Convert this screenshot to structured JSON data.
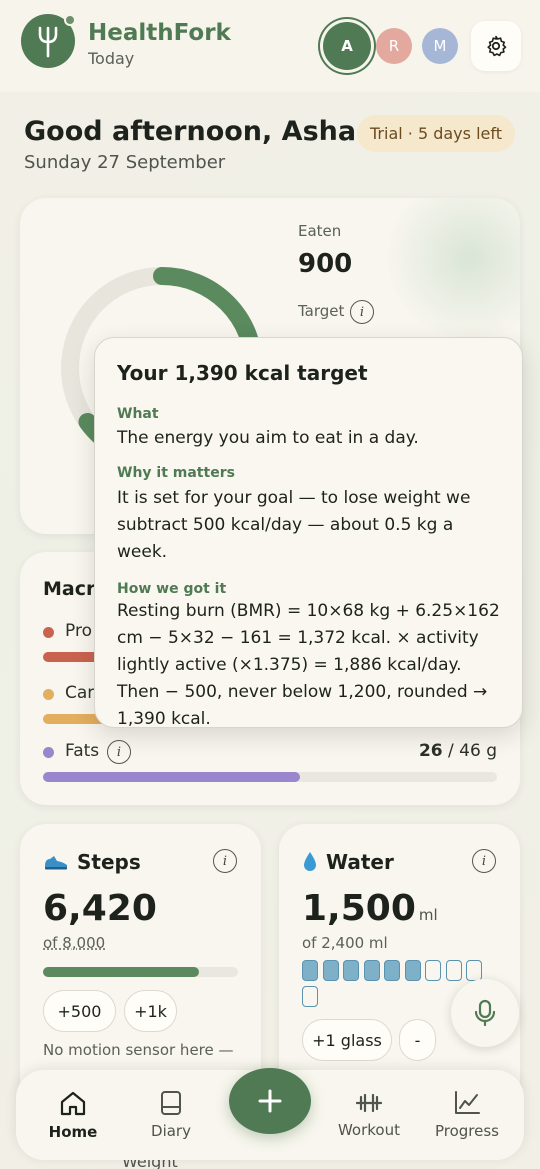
{
  "header": {
    "brand": "HealthFork",
    "subtitle": "Today",
    "avatars": [
      {
        "initial": "A",
        "color": "#4f7a53"
      },
      {
        "initial": "R",
        "color": "#e3a89e"
      },
      {
        "initial": "M",
        "color": "#a5b6d6"
      }
    ],
    "settings_icon": "gear-icon"
  },
  "greeting": {
    "title": "Good afternoon, Asha",
    "date": "Sunday 27 September",
    "trial": "Trial · 5 days left"
  },
  "calories": {
    "eaten_label": "Eaten",
    "eaten_value": "900",
    "target_label": "Target",
    "progress_fraction": 0.65
  },
  "popover": {
    "title": "Your 1,390 kcal target",
    "what_heading": "What",
    "what_text": "The energy you aim to eat in a day.",
    "why_heading": "Why it matters",
    "why_text": "It is set for your goal — to lose weight we subtract 500 kcal/day — about 0.5 kg a week.",
    "how_heading": "How we got it",
    "how_text": "Resting burn (BMR) = 10×68 kg + 6.25×162 cm − 5×32 − 161 = 1,372 kcal. × activity lightly active (×1.375) = 1,886 kcal/day. Then − 500, never below 1,200, rounded → 1,390 kcal."
  },
  "macros": {
    "title": "Macr",
    "protein_label": "Pro",
    "carbs_label": "Car",
    "fats_label": "Fats",
    "fats_eaten": "26",
    "fats_target": "/ 46 g",
    "fats_fraction": 0.565,
    "colors": {
      "protein": "#c9634f",
      "carbs": "#e3ae5e",
      "fats": "#9a86cc"
    }
  },
  "steps": {
    "title": "Steps",
    "value": "6,420",
    "goal": "of 8,000",
    "fraction": 0.8,
    "btn_500": "+500",
    "btn_1k": "+1k",
    "hint": "No motion sensor here —"
  },
  "water": {
    "title": "Water",
    "value": "1,500",
    "unit": "ml",
    "goal": "of 2,400 ml",
    "glasses_filled": 6,
    "glasses_total": 10,
    "btn_glass": "+1 glass",
    "btn_minus": "-"
  },
  "nav": {
    "home": "Home",
    "diary": "Diary",
    "workout": "Workout",
    "progress": "Progress"
  },
  "peek": {
    "weight": "Weight"
  }
}
